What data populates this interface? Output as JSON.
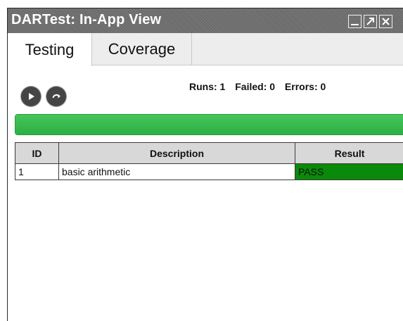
{
  "window": {
    "title": "DARTest: In-App View",
    "buttons": [
      "minimize-icon",
      "maximize-icon",
      "close-icon"
    ]
  },
  "tabs": [
    {
      "label": "Testing",
      "selected": true
    },
    {
      "label": "Coverage",
      "selected": false
    }
  ],
  "controls": {
    "run_icon": "play-icon",
    "rerun_icon": "rerun-icon"
  },
  "stats": {
    "runs": "Runs: 1",
    "failed": "Failed: 0",
    "errors": "Errors: 0"
  },
  "progress": {
    "fraction": 1.0,
    "color": "#36b84d"
  },
  "table": {
    "columns": [
      "ID",
      "Description",
      "Result"
    ],
    "rows": [
      {
        "id": "1",
        "description": "basic arithmetic",
        "result": "PASS",
        "result_color": "#0a8a0a"
      }
    ]
  }
}
